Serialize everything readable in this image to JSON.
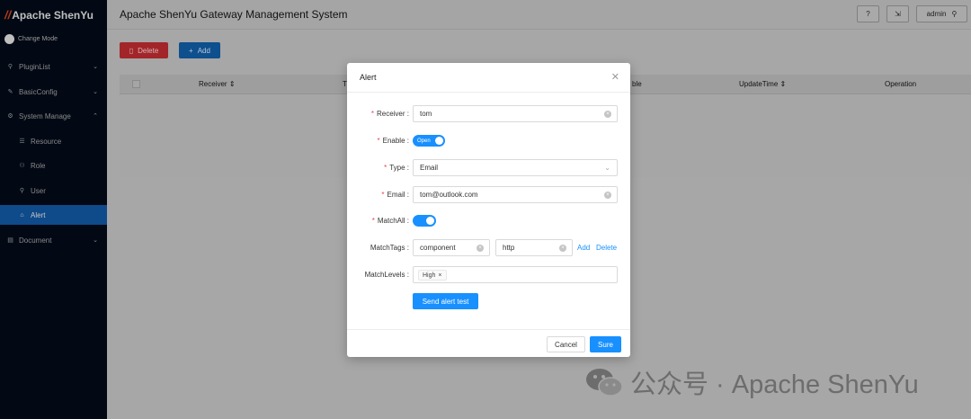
{
  "app": {
    "logo_text": "Apache ShenYu",
    "title": "Apache ShenYu Gateway Management System",
    "user": "admin"
  },
  "sidebar": {
    "change_mode": "Change Mode",
    "items": [
      {
        "label": "PluginList",
        "icon": "plugin-icon",
        "chevron": "⌄"
      },
      {
        "label": "BasicConfig",
        "icon": "wrench-icon",
        "chevron": "⌄"
      },
      {
        "label": "System Manage",
        "icon": "gear-icon",
        "chevron": "⌃"
      },
      {
        "label": "Resource",
        "icon": "list-icon"
      },
      {
        "label": "Role",
        "icon": "role-icon"
      },
      {
        "label": "User",
        "icon": "user-icon"
      },
      {
        "label": "Alert",
        "icon": "alert-icon",
        "active": true
      },
      {
        "label": "Document",
        "icon": "document-icon",
        "chevron": "⌄"
      }
    ]
  },
  "toolbar": {
    "delete_label": "Delete",
    "add_label": "Add"
  },
  "table": {
    "columns": [
      "Receiver",
      "T",
      "ble",
      "UpdateTime",
      "Operation"
    ]
  },
  "modal": {
    "title": "Alert",
    "fields": {
      "receiver": {
        "label": "Receiver",
        "value": "tom"
      },
      "enable": {
        "label": "Enable",
        "value": "Open"
      },
      "type": {
        "label": "Type",
        "value": "Email"
      },
      "email": {
        "label": "Email",
        "value": "tom@outlook.com"
      },
      "match_all": {
        "label": "MatchAll"
      },
      "match_tags": {
        "label": "MatchTags",
        "values": [
          "component",
          "http"
        ],
        "add": "Add",
        "delete": "Delete"
      },
      "match_levels": {
        "label": "MatchLevels",
        "tags": [
          "High"
        ]
      }
    },
    "test_button": "Send alert test",
    "cancel": "Cancel",
    "sure": "Sure"
  },
  "watermark": {
    "text": "公众号 · Apache ShenYu"
  },
  "colors": {
    "primary": "#1890ff",
    "danger": "#a22529",
    "sidebar": "#020914",
    "required": "#e5484d"
  }
}
